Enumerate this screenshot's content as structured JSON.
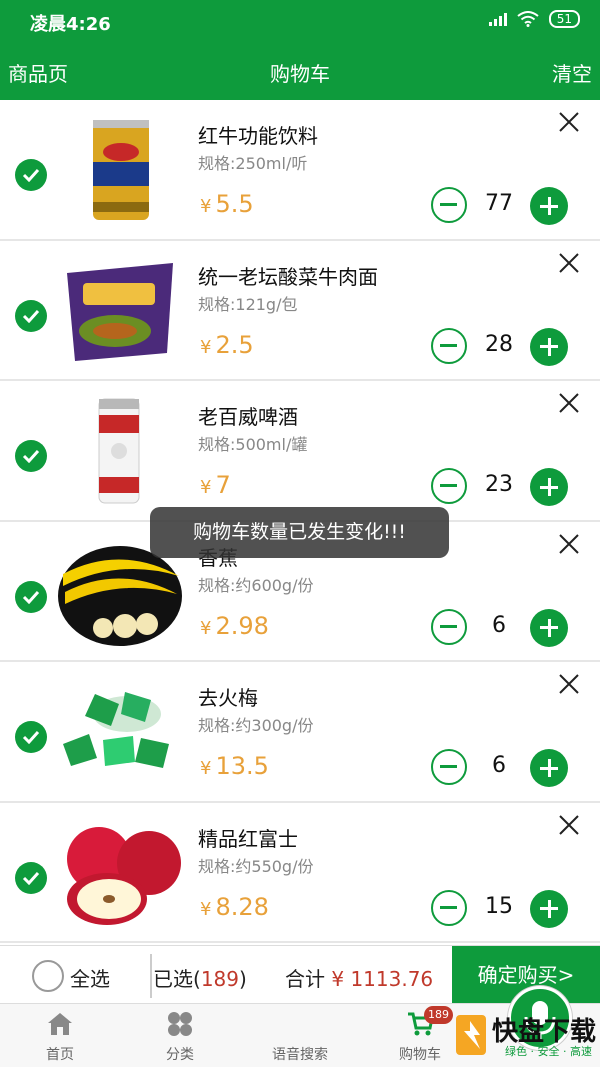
{
  "status_bar": {
    "time": "凌晨4:26",
    "battery": "51"
  },
  "navbar": {
    "left": "商品页",
    "title": "购物车",
    "right": "清空"
  },
  "colors": {
    "brand": "#0e9b3c",
    "price": "#e8a13a",
    "total": "#c0392b"
  },
  "cart_items": [
    {
      "name": "红牛功能饮料",
      "spec": "规格:250ml/听",
      "currency": "¥",
      "price": "5.5",
      "qty": "77",
      "checked": true
    },
    {
      "name": "统一老坛酸菜牛肉面",
      "spec": "规格:121g/包",
      "currency": "¥",
      "price": "2.5",
      "qty": "28",
      "checked": true
    },
    {
      "name": "老百威啤酒",
      "spec": "规格:500ml/罐",
      "currency": "¥",
      "price": "7",
      "qty": "23",
      "checked": true
    },
    {
      "name": "香蕉",
      "spec": "规格:约600g/份",
      "currency": "¥",
      "price": "2.98",
      "qty": "6",
      "checked": true
    },
    {
      "name": "去火梅",
      "spec": "规格:约300g/份",
      "currency": "¥",
      "price": "13.5",
      "qty": "6",
      "checked": true
    },
    {
      "name": "精品红富士",
      "spec": "规格:约550g/份",
      "currency": "¥",
      "price": "8.28",
      "qty": "15",
      "checked": true
    }
  ],
  "toast": "购物车数量已发生变化!!!",
  "summary": {
    "select_all": "全选",
    "selected_prefix": "已选(",
    "selected_count": "189",
    "selected_suffix": ")",
    "total_label": "合计",
    "total_amount": "¥ 1113.76",
    "confirm": "确定购买>"
  },
  "tabbar": {
    "tabs": [
      "首页",
      "分类",
      "语音搜索",
      "购物车"
    ],
    "cart_badge": "189"
  },
  "watermark": {
    "text": "快盘下载",
    "sub": "绿色 · 安全 · 高速"
  }
}
